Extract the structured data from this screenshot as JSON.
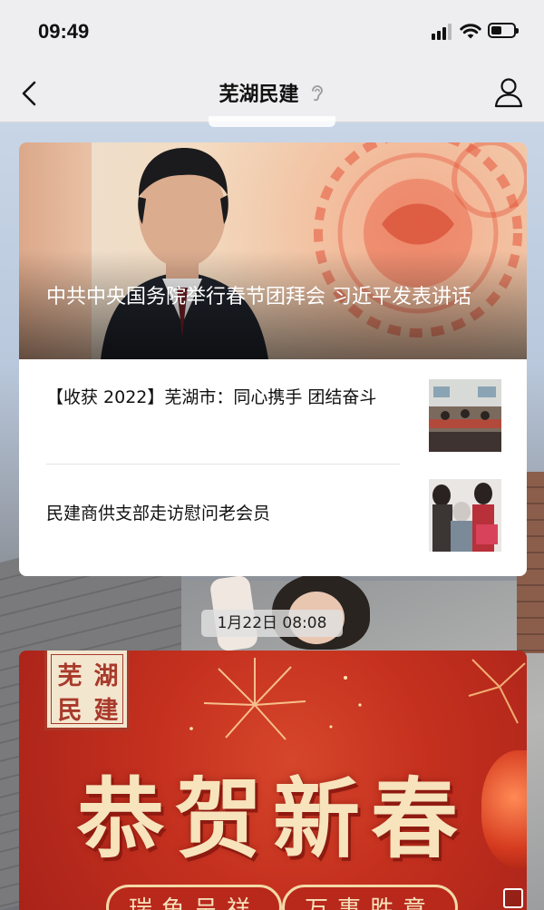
{
  "status_bar": {
    "time": "09:49"
  },
  "nav": {
    "title": "芜湖民建"
  },
  "article": {
    "lead_title": "中共中央国务院举行春节团拜会 习近平发表讲话",
    "items": [
      {
        "title": "【收获 2022】芜湖市：同心携手 团结奋斗"
      },
      {
        "title": "民建商供支部走访慰问老会员"
      }
    ]
  },
  "timestamp": "1月22日 08:08",
  "greeting": {
    "seal_chars": [
      "芜",
      "湖",
      "民",
      "建"
    ],
    "title": "恭贺新春",
    "phrases": [
      "瑞鱼呈祥",
      "万事胜意"
    ]
  },
  "colors": {
    "accent_red": "#c4301e",
    "nav_bg": "#eeeef0",
    "card_bg": "#ffffff"
  },
  "icons": [
    "back-arrow-icon",
    "ear-icon",
    "profile-icon",
    "signal-icon",
    "wifi-icon",
    "battery-icon"
  ]
}
